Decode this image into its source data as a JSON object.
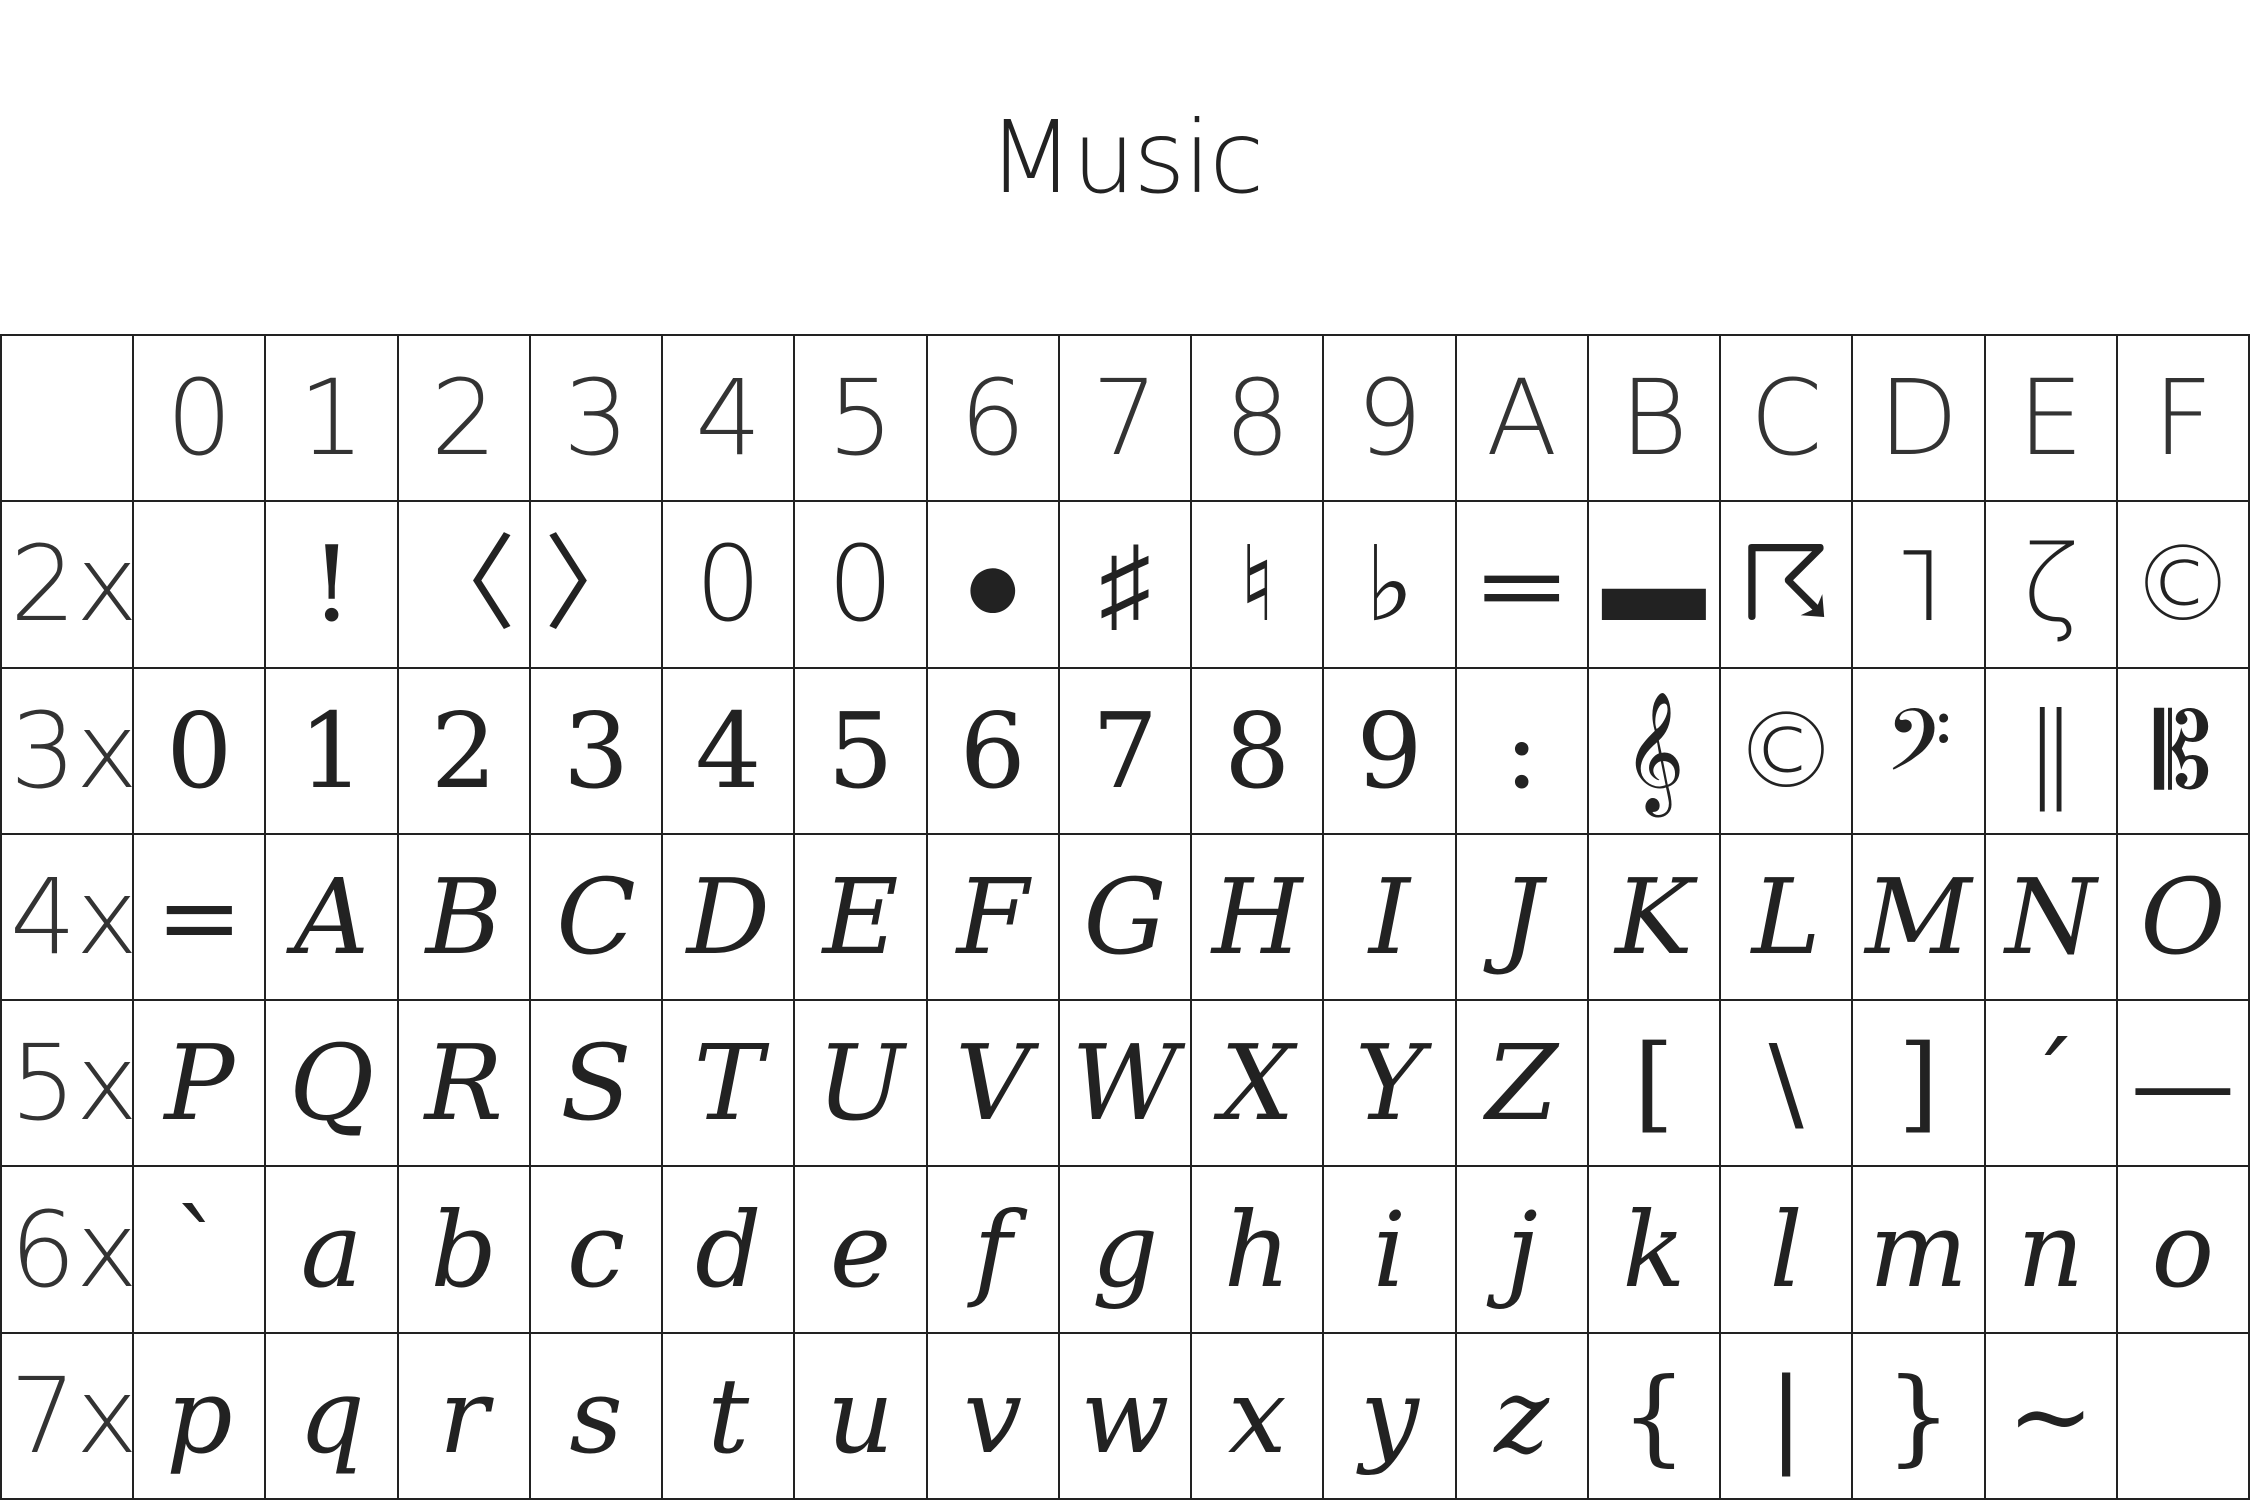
{
  "title": "Music",
  "columns": [
    "",
    "0",
    "1",
    "2",
    "3",
    "4",
    "5",
    "6",
    "7",
    "8",
    "9",
    "A",
    "B",
    "C",
    "D",
    "E",
    "F"
  ],
  "rows": [
    {
      "label": "2x",
      "cells": [
        {
          "glyph": "",
          "name": "blank"
        },
        {
          "glyph": "!",
          "name": "exclamation",
          "style": "upright"
        },
        {
          "glyph": "〈",
          "name": "flag-down-icon",
          "style": "music"
        },
        {
          "glyph": "〉",
          "name": "flag-up-icon",
          "style": "music"
        },
        {
          "glyph": "0",
          "name": "whole-note-icon",
          "style": "music"
        },
        {
          "glyph": "0",
          "name": "half-note-head-icon",
          "style": "music"
        },
        {
          "glyph": "●",
          "name": "quarter-note-head-icon",
          "style": "music"
        },
        {
          "glyph": "♯",
          "name": "sharp-icon",
          "style": "music"
        },
        {
          "glyph": "♮",
          "name": "natural-icon",
          "style": "music"
        },
        {
          "glyph": "♭",
          "name": "flat-icon",
          "style": "music"
        },
        {
          "glyph": "═",
          "name": "whole-rest-icon",
          "style": "music"
        },
        {
          "glyph": "▬",
          "name": "half-rest-icon",
          "style": "music"
        },
        {
          "glyph": "☈",
          "name": "eighth-rest-icon",
          "style": "music"
        },
        {
          "glyph": "˥",
          "name": "sixteenth-rest-icon",
          "style": "music"
        },
        {
          "glyph": "ζ",
          "name": "quarter-rest-icon",
          "style": "music"
        },
        {
          "glyph": "©",
          "name": "c-clef-small-icon",
          "style": "music"
        }
      ]
    },
    {
      "label": "3x",
      "cells": [
        {
          "glyph": "0",
          "name": "digit-0",
          "style": "upright"
        },
        {
          "glyph": "1",
          "name": "digit-1",
          "style": "upright"
        },
        {
          "glyph": "2",
          "name": "digit-2",
          "style": "upright"
        },
        {
          "glyph": "3",
          "name": "digit-3",
          "style": "upright"
        },
        {
          "glyph": "4",
          "name": "digit-4",
          "style": "upright"
        },
        {
          "glyph": "5",
          "name": "digit-5",
          "style": "upright"
        },
        {
          "glyph": "6",
          "name": "digit-6",
          "style": "upright"
        },
        {
          "glyph": "7",
          "name": "digit-7",
          "style": "upright"
        },
        {
          "glyph": "8",
          "name": "digit-8",
          "style": "upright"
        },
        {
          "glyph": "9",
          "name": "digit-9",
          "style": "upright"
        },
        {
          "glyph": ":",
          "name": "colon",
          "style": "upright"
        },
        {
          "glyph": "𝄞",
          "name": "treble-clef-icon",
          "style": "music"
        },
        {
          "glyph": "©",
          "name": "alto-clef-icon",
          "style": "music"
        },
        {
          "glyph": "𝄢",
          "name": "bass-clef-icon",
          "style": "music"
        },
        {
          "glyph": "‖",
          "name": "repeat-bar-icon",
          "style": "music"
        },
        {
          "glyph": "𝄡",
          "name": "c-clef-icon",
          "style": "music"
        }
      ]
    },
    {
      "label": "4x",
      "cells": [
        {
          "glyph": "=",
          "name": "equals",
          "style": "upright"
        },
        {
          "glyph": "A",
          "name": "letter-A"
        },
        {
          "glyph": "B",
          "name": "letter-B"
        },
        {
          "glyph": "C",
          "name": "letter-C"
        },
        {
          "glyph": "D",
          "name": "letter-D"
        },
        {
          "glyph": "E",
          "name": "letter-E"
        },
        {
          "glyph": "F",
          "name": "letter-F"
        },
        {
          "glyph": "G",
          "name": "letter-G"
        },
        {
          "glyph": "H",
          "name": "letter-H"
        },
        {
          "glyph": "I",
          "name": "letter-I"
        },
        {
          "glyph": "J",
          "name": "letter-J"
        },
        {
          "glyph": "K",
          "name": "letter-K"
        },
        {
          "glyph": "L",
          "name": "letter-L"
        },
        {
          "glyph": "M",
          "name": "letter-M"
        },
        {
          "glyph": "N",
          "name": "letter-N"
        },
        {
          "glyph": "O",
          "name": "letter-O"
        }
      ]
    },
    {
      "label": "5x",
      "cells": [
        {
          "glyph": "P",
          "name": "letter-P"
        },
        {
          "glyph": "Q",
          "name": "letter-Q"
        },
        {
          "glyph": "R",
          "name": "letter-R"
        },
        {
          "glyph": "S",
          "name": "letter-S"
        },
        {
          "glyph": "T",
          "name": "letter-T"
        },
        {
          "glyph": "U",
          "name": "letter-U"
        },
        {
          "glyph": "V",
          "name": "letter-V"
        },
        {
          "glyph": "W",
          "name": "letter-W"
        },
        {
          "glyph": "X",
          "name": "letter-X"
        },
        {
          "glyph": "Y",
          "name": "letter-Y"
        },
        {
          "glyph": "Z",
          "name": "letter-Z"
        },
        {
          "glyph": "[",
          "name": "left-bracket",
          "style": "upright"
        },
        {
          "glyph": "\\",
          "name": "backslash",
          "style": "upright"
        },
        {
          "glyph": "]",
          "name": "right-bracket",
          "style": "upright"
        },
        {
          "glyph": "´",
          "name": "acute-accent",
          "style": "upright"
        },
        {
          "glyph": "—",
          "name": "em-dash",
          "style": "upright"
        }
      ]
    },
    {
      "label": "6x",
      "cells": [
        {
          "glyph": "`",
          "name": "grave-accent",
          "style": "upright"
        },
        {
          "glyph": "a",
          "name": "letter-a"
        },
        {
          "glyph": "b",
          "name": "letter-b"
        },
        {
          "glyph": "c",
          "name": "letter-c"
        },
        {
          "glyph": "d",
          "name": "letter-d"
        },
        {
          "glyph": "e",
          "name": "letter-e"
        },
        {
          "glyph": "f",
          "name": "letter-f"
        },
        {
          "glyph": "g",
          "name": "letter-g"
        },
        {
          "glyph": "h",
          "name": "letter-h"
        },
        {
          "glyph": "i",
          "name": "letter-i"
        },
        {
          "glyph": "j",
          "name": "letter-j"
        },
        {
          "glyph": "k",
          "name": "letter-k"
        },
        {
          "glyph": "l",
          "name": "letter-l"
        },
        {
          "glyph": "m",
          "name": "letter-m"
        },
        {
          "glyph": "n",
          "name": "letter-n"
        },
        {
          "glyph": "o",
          "name": "letter-o"
        }
      ]
    },
    {
      "label": "7x",
      "cells": [
        {
          "glyph": "p",
          "name": "letter-p"
        },
        {
          "glyph": "q",
          "name": "letter-q"
        },
        {
          "glyph": "r",
          "name": "letter-r"
        },
        {
          "glyph": "s",
          "name": "letter-s"
        },
        {
          "glyph": "t",
          "name": "letter-t"
        },
        {
          "glyph": "u",
          "name": "letter-u"
        },
        {
          "glyph": "v",
          "name": "letter-v"
        },
        {
          "glyph": "w",
          "name": "letter-w"
        },
        {
          "glyph": "x",
          "name": "letter-x"
        },
        {
          "glyph": "y",
          "name": "letter-y"
        },
        {
          "glyph": "z",
          "name": "letter-z"
        },
        {
          "glyph": "{",
          "name": "left-brace",
          "style": "upright"
        },
        {
          "glyph": "|",
          "name": "vertical-bar",
          "style": "upright"
        },
        {
          "glyph": "}",
          "name": "right-brace",
          "style": "upright"
        },
        {
          "glyph": "~",
          "name": "tilde",
          "style": "upright"
        },
        {
          "glyph": "",
          "name": "blank"
        }
      ]
    }
  ]
}
